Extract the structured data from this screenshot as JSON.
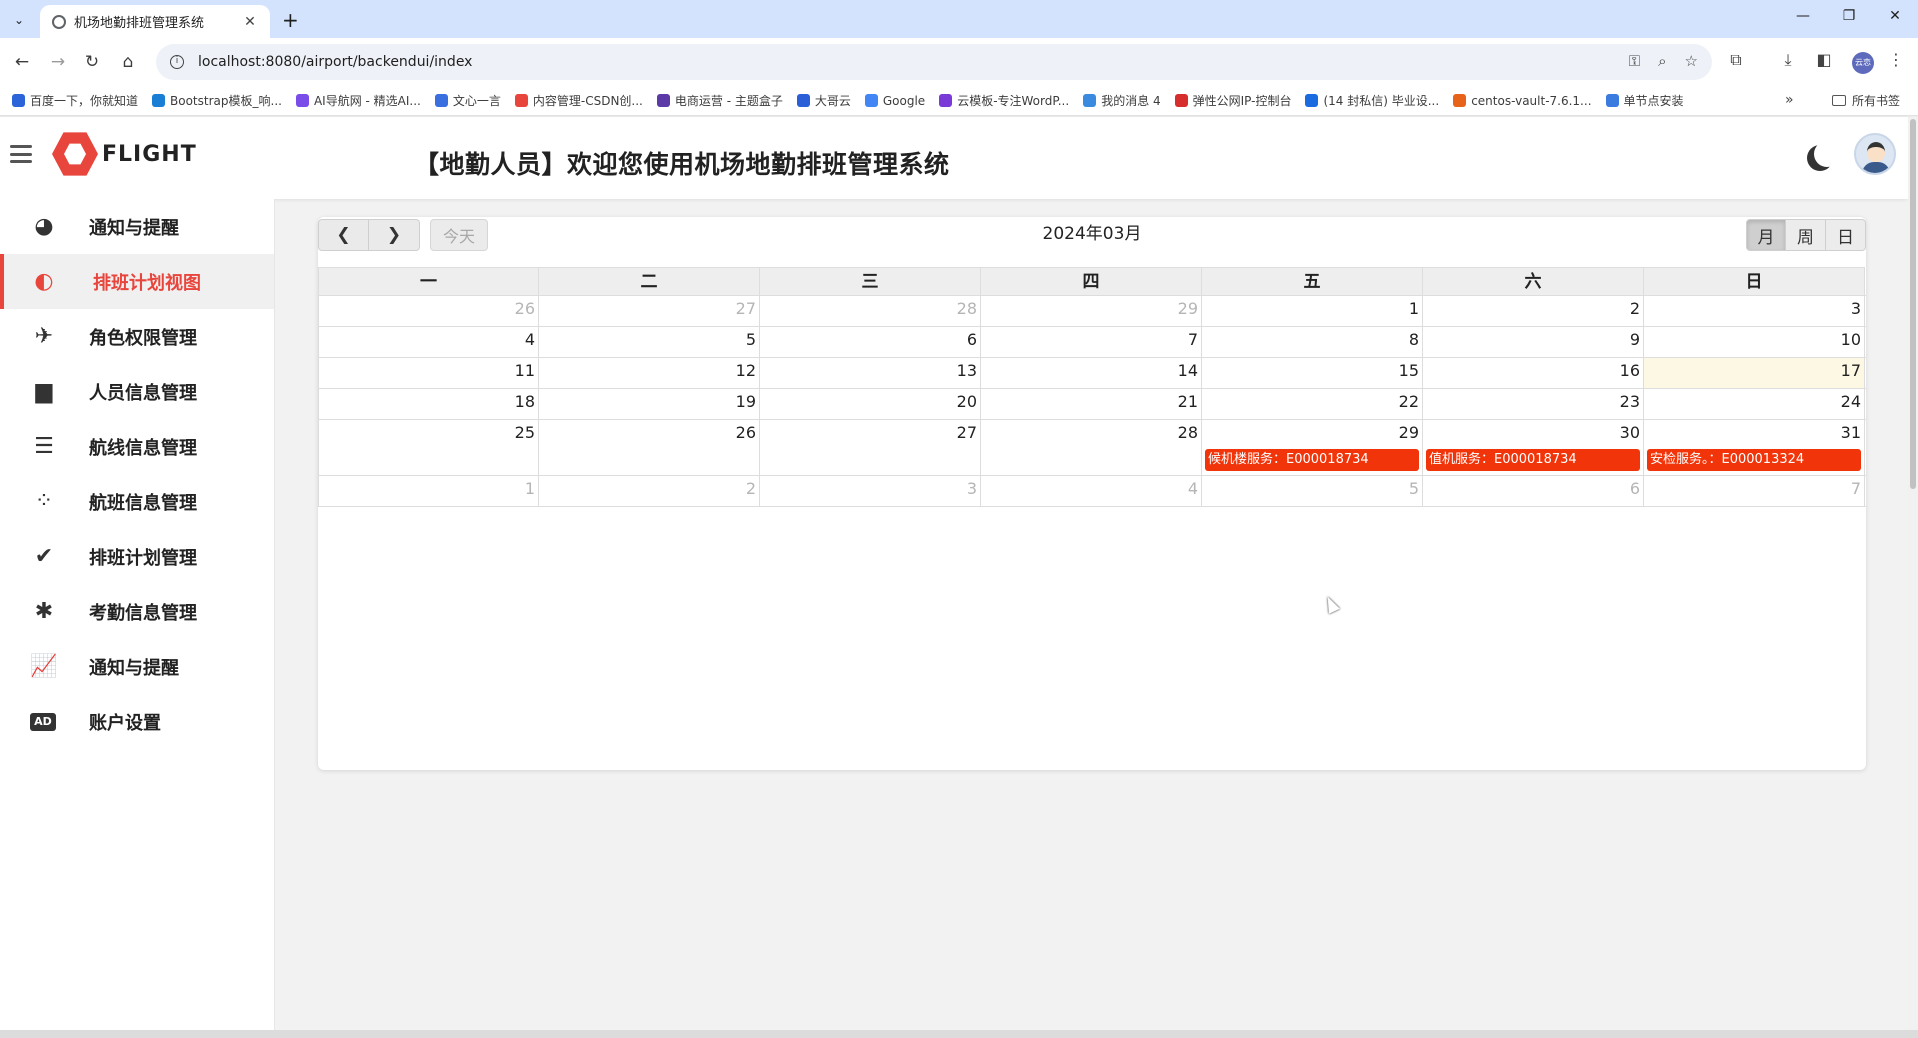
{
  "browser": {
    "tab_title": "机场地勤排班管理系统",
    "url": "localhost:8080/airport/backendui/index",
    "bookmarks": [
      {
        "label": "百度一下，你就知道",
        "color": "#2b63d9"
      },
      {
        "label": "Bootstrap模板_响...",
        "color": "#1a7fd4"
      },
      {
        "label": "AI导航网 - 精选AI...",
        "color": "#7b4de8"
      },
      {
        "label": "文心一言",
        "color": "#3a6fe0"
      },
      {
        "label": "内容管理-CSDN创...",
        "color": "#e8453c"
      },
      {
        "label": "电商运营 - 主题盒子",
        "color": "#5b3aa8"
      },
      {
        "label": "大哥云",
        "color": "#2a5fd8"
      },
      {
        "label": "Google",
        "color": "#4285f4"
      },
      {
        "label": "云模板-专注WordP...",
        "color": "#7a3ad8"
      },
      {
        "label": "我的消息 4",
        "color": "#3a8be0"
      },
      {
        "label": "弹性公网IP-控制台",
        "color": "#d62d2d"
      },
      {
        "label": "(14 封私信) 毕业设...",
        "color": "#1a6be0"
      },
      {
        "label": "centos-vault-7.6.1...",
        "color": "#e8631a"
      },
      {
        "label": "单节点安装",
        "color": "#3a7be0"
      }
    ],
    "bookmarks_more": "»",
    "all_bookmarks": "所有书签",
    "profile_text": "云恋"
  },
  "app": {
    "logo_text": "FLIGHT",
    "header_title": "【地勤人员】欢迎您使用机场地勤排班管理系统",
    "sidebar": [
      {
        "label": "通知与提醒",
        "icon": "dashboard-icon",
        "glyph": "◕",
        "active": false
      },
      {
        "label": "排班计划视图",
        "icon": "half-circle-icon",
        "glyph": "◐",
        "active": true
      },
      {
        "label": "角色权限管理",
        "icon": "plane-icon",
        "glyph": "✈",
        "active": false
      },
      {
        "label": "人员信息管理",
        "icon": "book-icon",
        "glyph": "▆",
        "active": false
      },
      {
        "label": "航线信息管理",
        "icon": "list-icon",
        "glyph": "☰",
        "active": false
      },
      {
        "label": "航班信息管理",
        "icon": "spinner-icon",
        "glyph": "⁘",
        "active": false
      },
      {
        "label": "排班计划管理",
        "icon": "check-circle-icon",
        "glyph": "✔",
        "active": false
      },
      {
        "label": "考勤信息管理",
        "icon": "bug-icon",
        "glyph": "✱",
        "active": false
      },
      {
        "label": "通知与提醒",
        "icon": "chart-line-icon",
        "glyph": "📈",
        "active": false
      },
      {
        "label": "账户设置",
        "icon": "ad-icon",
        "glyph": "AD",
        "active": false
      }
    ]
  },
  "calendar": {
    "title": "2024年03月",
    "prev": "<",
    "next": ">",
    "today": "今天",
    "views": [
      "月",
      "周",
      "日"
    ],
    "weekdays": [
      "一",
      "二",
      "三",
      "四",
      "五",
      "六",
      "日"
    ],
    "weeks": [
      {
        "days": [
          {
            "n": "26",
            "o": true
          },
          {
            "n": "27",
            "o": true
          },
          {
            "n": "28",
            "o": true
          },
          {
            "n": "29",
            "o": true
          },
          {
            "n": "1"
          },
          {
            "n": "2"
          },
          {
            "n": "3"
          }
        ]
      },
      {
        "days": [
          {
            "n": "4"
          },
          {
            "n": "5"
          },
          {
            "n": "6"
          },
          {
            "n": "7"
          },
          {
            "n": "8"
          },
          {
            "n": "9"
          },
          {
            "n": "10"
          }
        ]
      },
      {
        "days": [
          {
            "n": "11"
          },
          {
            "n": "12"
          },
          {
            "n": "13"
          },
          {
            "n": "14"
          },
          {
            "n": "15"
          },
          {
            "n": "16"
          },
          {
            "n": "17",
            "today": true
          }
        ]
      },
      {
        "days": [
          {
            "n": "18"
          },
          {
            "n": "19"
          },
          {
            "n": "20"
          },
          {
            "n": "21"
          },
          {
            "n": "22"
          },
          {
            "n": "23"
          },
          {
            "n": "24"
          }
        ]
      },
      {
        "days": [
          {
            "n": "25"
          },
          {
            "n": "26"
          },
          {
            "n": "27"
          },
          {
            "n": "28"
          },
          {
            "n": "29",
            "event": "候机楼服务：E000018734"
          },
          {
            "n": "30",
            "event": "值机服务：E000018734"
          },
          {
            "n": "31",
            "event": "安检服务。：E000013324"
          }
        ]
      },
      {
        "days": [
          {
            "n": "1",
            "o": true
          },
          {
            "n": "2",
            "o": true
          },
          {
            "n": "3",
            "o": true
          },
          {
            "n": "4",
            "o": true
          },
          {
            "n": "5",
            "o": true
          },
          {
            "n": "6",
            "o": true
          },
          {
            "n": "7",
            "o": true
          }
        ]
      }
    ],
    "event_color": "#f1340a",
    "today_color": "#fcf8e3"
  }
}
